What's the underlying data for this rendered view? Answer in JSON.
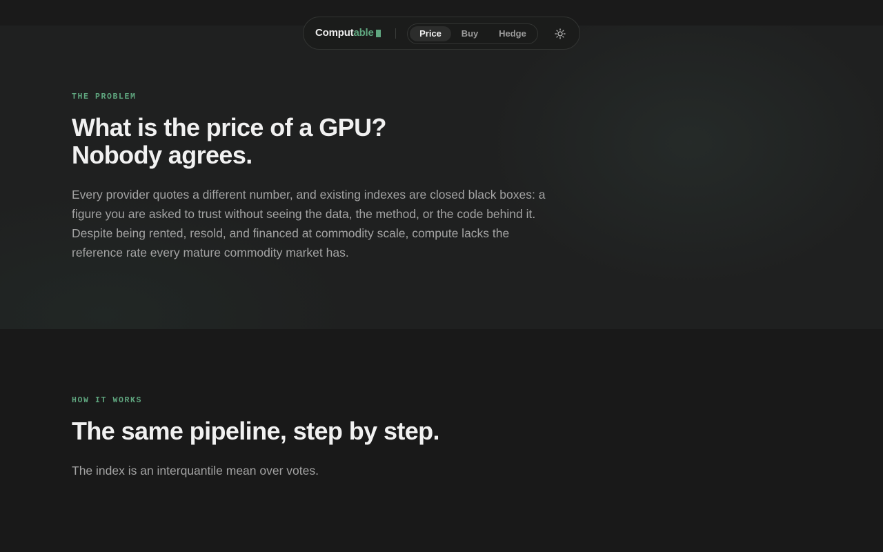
{
  "nav": {
    "brand_main": "Comput",
    "brand_accent": "able",
    "tabs": [
      {
        "label": "Price",
        "active": true
      },
      {
        "label": "Buy",
        "active": false
      },
      {
        "label": "Hedge",
        "active": false
      }
    ],
    "theme_icon": "sun-icon"
  },
  "colors": {
    "accent": "#5fa67f",
    "background": "#191919",
    "text_primary": "#f1f1f1",
    "text_secondary": "#a3a3a3"
  },
  "problem": {
    "eyebrow": "THE PROBLEM",
    "headline_line1": "What is the price of a GPU?",
    "headline_line2": "Nobody agrees.",
    "body": "Every provider quotes a different number, and existing indexes are closed black boxes: a figure you are asked to trust without seeing the data, the method, or the code behind it. Despite being rented, resold, and financed at commodity scale, compute lacks the reference rate every mature commodity market has."
  },
  "how": {
    "eyebrow": "HOW IT WORKS",
    "headline": "The same pipeline, step by step.",
    "body": "The index is an interquantile mean over votes."
  }
}
